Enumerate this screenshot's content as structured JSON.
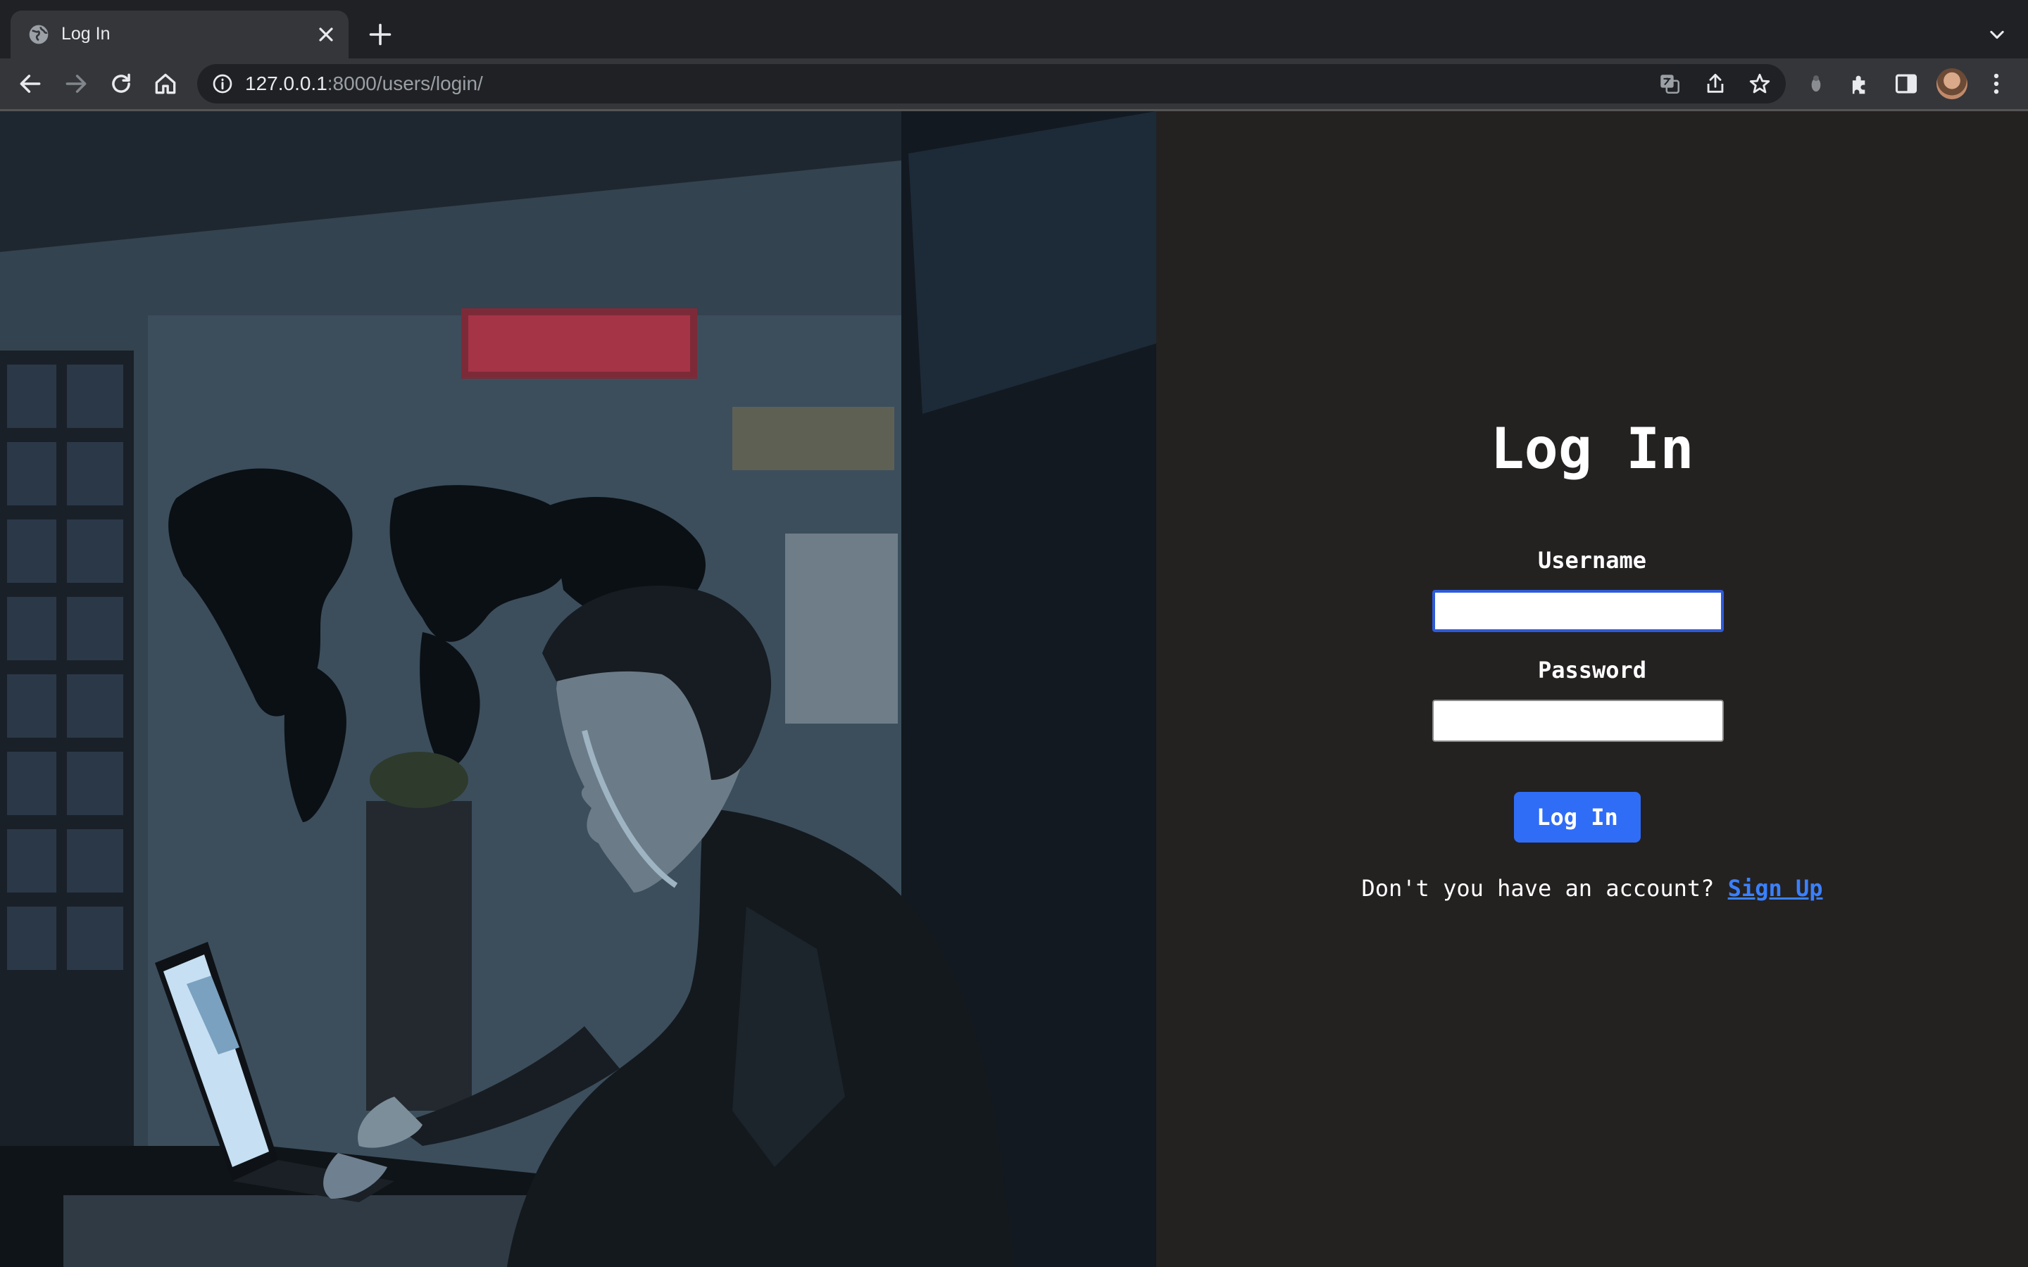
{
  "browser": {
    "tab_title": "Log In",
    "url_host": "127.0.0.1",
    "url_rest": ":8000/users/login/"
  },
  "page": {
    "title": "Log In",
    "username_label": "Username",
    "password_label": "Password",
    "username_value": "",
    "password_value": "",
    "login_button": "Log In",
    "signup_prompt": "Don't you have an account?",
    "signup_link": "Sign Up"
  },
  "colors": {
    "panel_bg": "#242121",
    "button_bg": "#2f6df6",
    "link": "#3a80ff",
    "focus_border": "#2e5bd8"
  },
  "icons": {
    "tab": [
      "globe-icon",
      "close-icon"
    ],
    "toolbar": [
      "back-arrow-icon",
      "forward-arrow-icon",
      "reload-icon",
      "home-icon",
      "info-icon"
    ],
    "omnibox_right": [
      "translate-icon",
      "share-icon",
      "star-icon"
    ],
    "extensions": [
      "extension-icon",
      "puzzle-icon",
      "side-panel-icon",
      "profile-avatar",
      "kebab-menu-icon"
    ]
  }
}
